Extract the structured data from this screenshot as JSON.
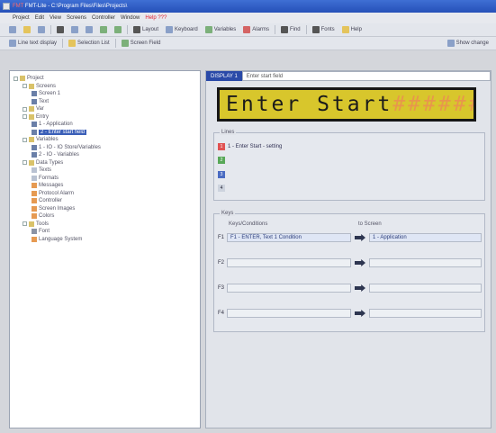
{
  "window": {
    "title": "FMT-Lite - C:\\Program Files\\Files\\Projects\\",
    "title_accent": "FMT"
  },
  "menu": {
    "items": [
      "Project",
      "Edit",
      "View",
      "Screens",
      "Controller",
      "Window",
      "Help"
    ],
    "accent_item": "Help ???"
  },
  "toolbar1": {
    "buttons": [
      "",
      "",
      "",
      "",
      "",
      "",
      "",
      "",
      "",
      "Layout",
      "Keyboard",
      "Variables",
      "Alarms",
      "",
      "Find",
      "",
      "",
      "Fonts",
      "Help"
    ]
  },
  "toolbar2": {
    "left_label": "Line text display",
    "mid_label": "Selection List",
    "mid2_label": "Screen Field",
    "right_label": "Show change"
  },
  "tree": {
    "nodes": [
      {
        "label": "Project",
        "level": 0,
        "icon": "folder"
      },
      {
        "label": "Screens",
        "level": 1,
        "icon": "folder"
      },
      {
        "label": "Screen 1",
        "level": 2,
        "icon": "screen"
      },
      {
        "label": "Text",
        "level": 2,
        "icon": "screen"
      },
      {
        "label": "Var",
        "level": 1,
        "icon": "folder"
      },
      {
        "label": "Entry",
        "level": 1,
        "icon": "folder"
      },
      {
        "label": "1 - Application",
        "level": 2,
        "icon": "screen"
      },
      {
        "label": "2 - Enter start field",
        "level": 2,
        "icon": "screen",
        "selected": true
      },
      {
        "label": "Variables",
        "level": 1,
        "icon": "folder"
      },
      {
        "label": "1 - IO - IO Store/Variables",
        "level": 2,
        "icon": "screen"
      },
      {
        "label": "2 - IO - Variables",
        "level": 2,
        "icon": "screen"
      },
      {
        "label": "Data Types",
        "level": 1,
        "icon": "folder"
      },
      {
        "label": "Texts",
        "level": 2,
        "icon": "text"
      },
      {
        "label": "Formats",
        "level": 2,
        "icon": "text"
      },
      {
        "label": "Messages",
        "level": 2,
        "icon": "orange"
      },
      {
        "label": "Protocol Alarm",
        "level": 2,
        "icon": "orange"
      },
      {
        "label": "Controller",
        "level": 2,
        "icon": "orange"
      },
      {
        "label": "Screen Images",
        "level": 2,
        "icon": "orange"
      },
      {
        "label": "Colors",
        "level": 2,
        "icon": "orange"
      },
      {
        "label": "Tools",
        "level": 1,
        "icon": "folder"
      },
      {
        "label": "Font",
        "level": 2,
        "icon": "sys"
      },
      {
        "label": "Language System",
        "level": 2,
        "icon": "orange"
      }
    ]
  },
  "editor": {
    "tab_label": "DISPLAY 1",
    "screen_name_value": "Enter start field",
    "lcd_text": "Enter Start",
    "lcd_cursor": "######"
  },
  "lines_group": {
    "title": "Lines",
    "lines": [
      {
        "num": "1",
        "color": "r",
        "text": "1 - Enter Start - setting"
      },
      {
        "num": "2",
        "color": "g",
        "text": ""
      },
      {
        "num": "3",
        "color": "b",
        "text": ""
      },
      {
        "num": "4",
        "color": "n",
        "text": ""
      }
    ]
  },
  "keys_group": {
    "title": "Keys",
    "col1_header": "Keys/Conditions",
    "col2_header": "to Screen",
    "rows": [
      {
        "idx": "F1",
        "left": "F1 - ENTER, Text 1 Condition",
        "right": "1 - Application",
        "active": true
      },
      {
        "idx": "F2",
        "left": "",
        "right": "",
        "active": false
      },
      {
        "idx": "F3",
        "left": "",
        "right": "",
        "active": false
      },
      {
        "idx": "F4",
        "left": "",
        "right": "",
        "active": false
      }
    ]
  },
  "colors": {
    "lcd_background": "#d8c62c",
    "tab_active": "#2a4aa8",
    "tree_selected": "#3b5fb8"
  }
}
